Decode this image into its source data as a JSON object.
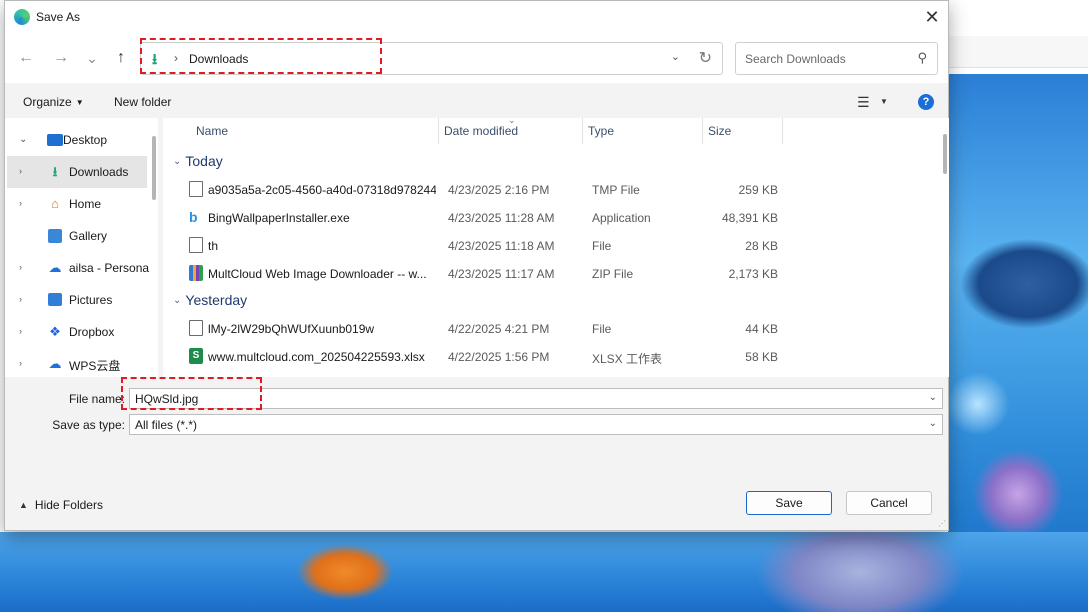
{
  "window": {
    "title": "Save As"
  },
  "nav": {
    "back": "←",
    "forward": "→",
    "recent": "⌄",
    "up": "↑"
  },
  "address": {
    "path": "Downloads"
  },
  "search": {
    "placeholder": "Search Downloads"
  },
  "toolbar": {
    "organize": "Organize",
    "new_folder": "New folder"
  },
  "sidebar": {
    "items": [
      {
        "label": "Desktop",
        "icon": "desktop-icon"
      },
      {
        "label": "Downloads",
        "icon": "download-icon"
      },
      {
        "label": "Home",
        "icon": "home-icon"
      },
      {
        "label": "Gallery",
        "icon": "gallery-icon"
      },
      {
        "label": "ailsa - Persona",
        "icon": "cloud-icon"
      },
      {
        "label": "Pictures",
        "icon": "pictures-icon"
      },
      {
        "label": "Dropbox",
        "icon": "dropbox-icon"
      },
      {
        "label": "WPS云盘",
        "icon": "cloud-icon"
      }
    ]
  },
  "columns": {
    "name": "Name",
    "date": "Date modified",
    "type": "Type",
    "size": "Size"
  },
  "groups": [
    {
      "label": "Today",
      "files": [
        {
          "name": "a9035a5a-2c05-4560-a40d-07318d978244....",
          "date": "4/23/2025 2:16 PM",
          "type": "TMP File",
          "size": "259 KB",
          "icon": "file-icon"
        },
        {
          "name": "BingWallpaperInstaller.exe",
          "date": "4/23/2025 11:28 AM",
          "type": "Application",
          "size": "48,391 KB",
          "icon": "bing-icon"
        },
        {
          "name": "th",
          "date": "4/23/2025 11:18 AM",
          "type": "File",
          "size": "28 KB",
          "icon": "file-icon"
        },
        {
          "name": "MultCloud Web Image Downloader -- w...",
          "date": "4/23/2025 11:17 AM",
          "type": "ZIP File",
          "size": "2,173 KB",
          "icon": "zip-icon"
        }
      ]
    },
    {
      "label": "Yesterday",
      "files": [
        {
          "name": "lMy-2lW29bQhWUfXuunb019w",
          "date": "4/22/2025 4:21 PM",
          "type": "File",
          "size": "44 KB",
          "icon": "file-icon"
        },
        {
          "name": "www.multcloud.com_202504225593.xlsx",
          "date": "4/22/2025 1:56 PM",
          "type": "XLSX 工作表",
          "size": "58 KB",
          "icon": "xlsx-icon"
        }
      ]
    }
  ],
  "form": {
    "file_name_label": "File name:",
    "file_name_value": "HQwSld.jpg",
    "save_type_label": "Save as type:",
    "save_type_value": "All files (*.*)"
  },
  "footer": {
    "hide_folders": "Hide Folders",
    "save": "Save",
    "cancel": "Cancel"
  },
  "colors": {
    "accent": "#1b66c9",
    "highlight": "#e01b24",
    "download_green": "#1ba672"
  }
}
